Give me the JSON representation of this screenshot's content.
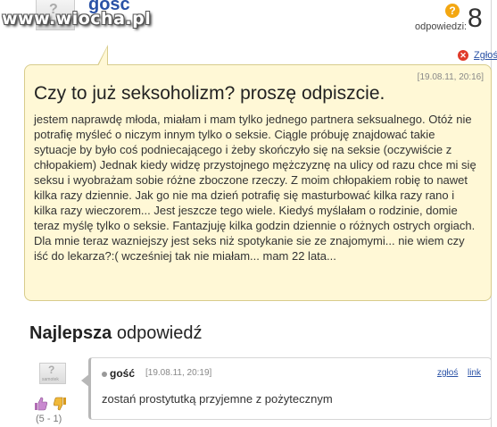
{
  "watermark": "www.wiocha.pl",
  "question": {
    "author": "gośc",
    "answers_label": "odpowiedzi:",
    "answers_count": "8",
    "report_label": "Zgłoś",
    "date": "[19.08.11, 20:16]",
    "title": "Czy to już seksoholizm? proszę odpiszcie.",
    "body": "jestem naprawdę młoda, miałam i mam tylko jednego partnera seksualnego. Otóż nie potrafię myśleć o niczym innym tylko o seksie. Ciągle próbuję znajdować takie sytuacje by było coś podniecającego i żeby skończyło się na seksie (oczywiście z chłopakiem) Jednak kiedy widzę przystojnego mężczyznę na ulicy od razu chce mi się seksu i wyobrażam sobie różne zboczone rzeczy. Z moim chłopakiem robię to nawet kilka razy dziennie. Jak go nie ma dzień potrafię się masturbować kilka razy rano i kilka razy wieczorem... Jest jeszcze tego wiele. Kiedyś myślałam o rodzinie, domie teraz myślę tylko o seksie. Fantazjuję kilka godzin dziennie o różnych ostrych orgiach. Dla mnie teraz wazniejszy jest seks niż spotykanie sie ze znajomymi... nie wiem czy iść do lekarza?:( wcześniej tak nie miałam... mam 22 lata..."
  },
  "best_answer": {
    "heading_bold": "Najlepsza",
    "heading_rest": " odpowiedź",
    "author": "gość",
    "date": "[19.08.11, 20:19]",
    "report_label": "zgłoś",
    "link_label": "link",
    "text": "zostań prostytutką przyjemne z pożytecznym",
    "vote_score": "(5 - 1)"
  },
  "avatar_label": "samotek",
  "colors": {
    "bubble_bg": "#fff8d6",
    "bubble_border": "#d8cc8c",
    "link": "#2a52a6",
    "badge": "#f3a712"
  }
}
